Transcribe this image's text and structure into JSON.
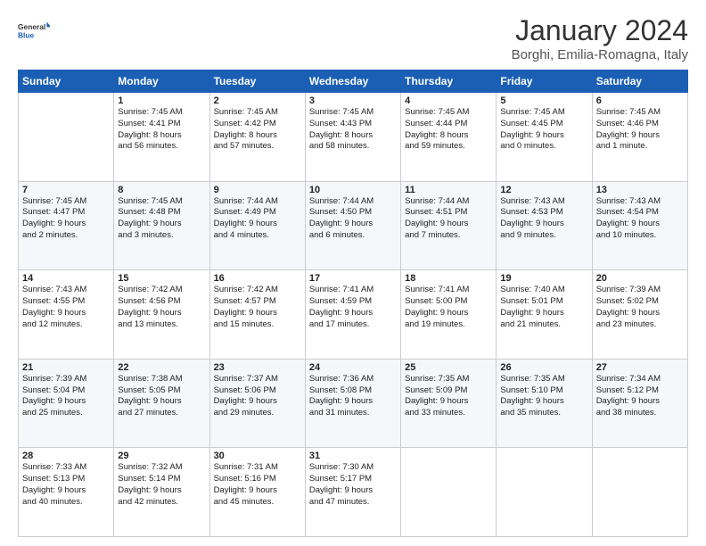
{
  "logo": {
    "line1": "General",
    "line2": "Blue"
  },
  "title": "January 2024",
  "location": "Borghi, Emilia-Romagna, Italy",
  "days_of_week": [
    "Sunday",
    "Monday",
    "Tuesday",
    "Wednesday",
    "Thursday",
    "Friday",
    "Saturday"
  ],
  "weeks": [
    [
      {
        "day": "",
        "content": ""
      },
      {
        "day": "1",
        "content": "Sunrise: 7:45 AM\nSunset: 4:41 PM\nDaylight: 8 hours\nand 56 minutes."
      },
      {
        "day": "2",
        "content": "Sunrise: 7:45 AM\nSunset: 4:42 PM\nDaylight: 8 hours\nand 57 minutes."
      },
      {
        "day": "3",
        "content": "Sunrise: 7:45 AM\nSunset: 4:43 PM\nDaylight: 8 hours\nand 58 minutes."
      },
      {
        "day": "4",
        "content": "Sunrise: 7:45 AM\nSunset: 4:44 PM\nDaylight: 8 hours\nand 59 minutes."
      },
      {
        "day": "5",
        "content": "Sunrise: 7:45 AM\nSunset: 4:45 PM\nDaylight: 9 hours\nand 0 minutes."
      },
      {
        "day": "6",
        "content": "Sunrise: 7:45 AM\nSunset: 4:46 PM\nDaylight: 9 hours\nand 1 minute."
      }
    ],
    [
      {
        "day": "7",
        "content": "Sunrise: 7:45 AM\nSunset: 4:47 PM\nDaylight: 9 hours\nand 2 minutes."
      },
      {
        "day": "8",
        "content": "Sunrise: 7:45 AM\nSunset: 4:48 PM\nDaylight: 9 hours\nand 3 minutes."
      },
      {
        "day": "9",
        "content": "Sunrise: 7:44 AM\nSunset: 4:49 PM\nDaylight: 9 hours\nand 4 minutes."
      },
      {
        "day": "10",
        "content": "Sunrise: 7:44 AM\nSunset: 4:50 PM\nDaylight: 9 hours\nand 6 minutes."
      },
      {
        "day": "11",
        "content": "Sunrise: 7:44 AM\nSunset: 4:51 PM\nDaylight: 9 hours\nand 7 minutes."
      },
      {
        "day": "12",
        "content": "Sunrise: 7:43 AM\nSunset: 4:53 PM\nDaylight: 9 hours\nand 9 minutes."
      },
      {
        "day": "13",
        "content": "Sunrise: 7:43 AM\nSunset: 4:54 PM\nDaylight: 9 hours\nand 10 minutes."
      }
    ],
    [
      {
        "day": "14",
        "content": "Sunrise: 7:43 AM\nSunset: 4:55 PM\nDaylight: 9 hours\nand 12 minutes."
      },
      {
        "day": "15",
        "content": "Sunrise: 7:42 AM\nSunset: 4:56 PM\nDaylight: 9 hours\nand 13 minutes."
      },
      {
        "day": "16",
        "content": "Sunrise: 7:42 AM\nSunset: 4:57 PM\nDaylight: 9 hours\nand 15 minutes."
      },
      {
        "day": "17",
        "content": "Sunrise: 7:41 AM\nSunset: 4:59 PM\nDaylight: 9 hours\nand 17 minutes."
      },
      {
        "day": "18",
        "content": "Sunrise: 7:41 AM\nSunset: 5:00 PM\nDaylight: 9 hours\nand 19 minutes."
      },
      {
        "day": "19",
        "content": "Sunrise: 7:40 AM\nSunset: 5:01 PM\nDaylight: 9 hours\nand 21 minutes."
      },
      {
        "day": "20",
        "content": "Sunrise: 7:39 AM\nSunset: 5:02 PM\nDaylight: 9 hours\nand 23 minutes."
      }
    ],
    [
      {
        "day": "21",
        "content": "Sunrise: 7:39 AM\nSunset: 5:04 PM\nDaylight: 9 hours\nand 25 minutes."
      },
      {
        "day": "22",
        "content": "Sunrise: 7:38 AM\nSunset: 5:05 PM\nDaylight: 9 hours\nand 27 minutes."
      },
      {
        "day": "23",
        "content": "Sunrise: 7:37 AM\nSunset: 5:06 PM\nDaylight: 9 hours\nand 29 minutes."
      },
      {
        "day": "24",
        "content": "Sunrise: 7:36 AM\nSunset: 5:08 PM\nDaylight: 9 hours\nand 31 minutes."
      },
      {
        "day": "25",
        "content": "Sunrise: 7:35 AM\nSunset: 5:09 PM\nDaylight: 9 hours\nand 33 minutes."
      },
      {
        "day": "26",
        "content": "Sunrise: 7:35 AM\nSunset: 5:10 PM\nDaylight: 9 hours\nand 35 minutes."
      },
      {
        "day": "27",
        "content": "Sunrise: 7:34 AM\nSunset: 5:12 PM\nDaylight: 9 hours\nand 38 minutes."
      }
    ],
    [
      {
        "day": "28",
        "content": "Sunrise: 7:33 AM\nSunset: 5:13 PM\nDaylight: 9 hours\nand 40 minutes."
      },
      {
        "day": "29",
        "content": "Sunrise: 7:32 AM\nSunset: 5:14 PM\nDaylight: 9 hours\nand 42 minutes."
      },
      {
        "day": "30",
        "content": "Sunrise: 7:31 AM\nSunset: 5:16 PM\nDaylight: 9 hours\nand 45 minutes."
      },
      {
        "day": "31",
        "content": "Sunrise: 7:30 AM\nSunset: 5:17 PM\nDaylight: 9 hours\nand 47 minutes."
      },
      {
        "day": "",
        "content": ""
      },
      {
        "day": "",
        "content": ""
      },
      {
        "day": "",
        "content": ""
      }
    ]
  ]
}
